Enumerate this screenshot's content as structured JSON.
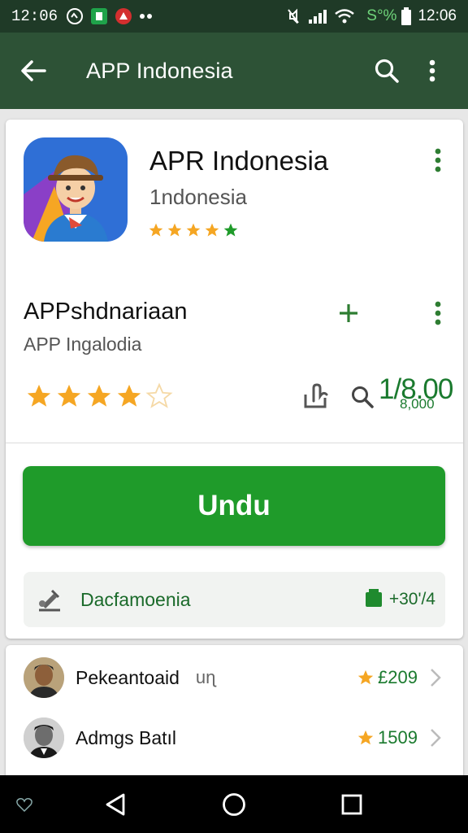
{
  "status_bar": {
    "time": "12:06",
    "battery_text": "S°%",
    "clock_right": "12:06",
    "icons": [
      "circle-notification-icon",
      "store-icon",
      "app-notification-icon",
      "more-dots-icon",
      "mute-icon",
      "signal-icon",
      "wifi-icon",
      "battery-icon"
    ]
  },
  "app_bar": {
    "title": "APP Indonesia",
    "icons": [
      "back-arrow-icon",
      "search-icon",
      "more-vert-icon"
    ]
  },
  "app_header": {
    "name": "APR Indonesia",
    "subtitle": "1ndonesia",
    "stars": 4.5
  },
  "detail": {
    "name": "APPshdnariaan",
    "subtitle": "APP Ingalodia",
    "rating_stars": 4,
    "count_main": "1/8.00",
    "count_sub": "8,000"
  },
  "install_button": {
    "label": "Undu"
  },
  "info_row": {
    "label": "Dacfamoenia",
    "value": "+30'/4"
  },
  "reviews": [
    {
      "name": "Pekeantoaid",
      "extra": "uɳ",
      "score": "£209"
    },
    {
      "name": "Admgs Batıl",
      "extra": "",
      "score": "1509"
    }
  ],
  "colors": {
    "status_bar": "#1f3a27",
    "app_bar": "#2d5236",
    "accent_green": "#1f9b2a",
    "star": "#f5a623"
  }
}
